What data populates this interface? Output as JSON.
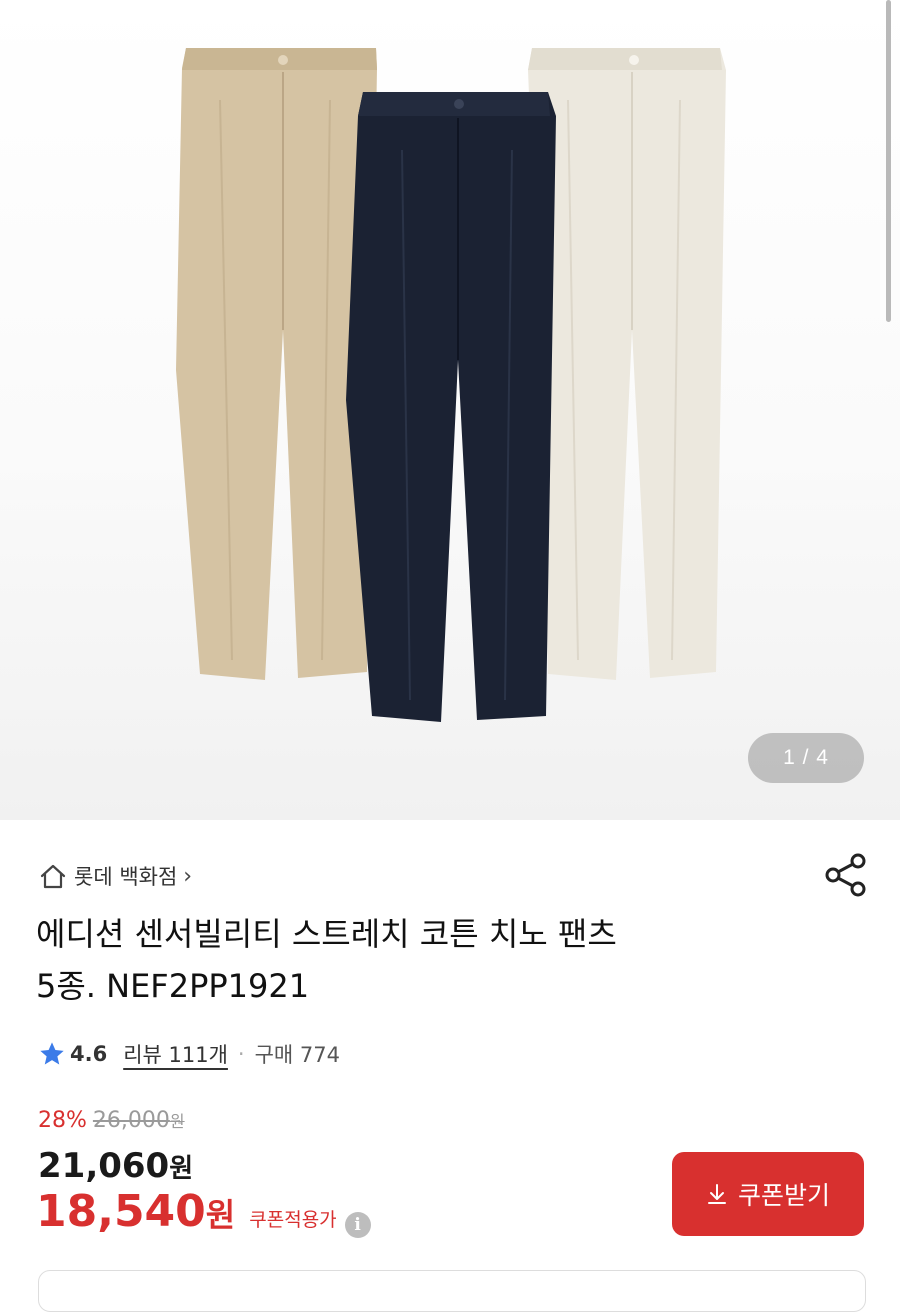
{
  "gallery": {
    "counter": "1 / 4",
    "image_alt": "chino-pants-three-colors",
    "colors": {
      "beige": "#d5c3a3",
      "navy": "#1b2233",
      "ivory": "#ece8de"
    }
  },
  "store": {
    "name": "롯데 백화점",
    "chevron": "›"
  },
  "product": {
    "title_line1": "에디션 센서빌리티 스트레치 코튼 치노 팬츠",
    "title_line2": "5종. NEF2PP1921"
  },
  "rating": {
    "score": "4.6",
    "reviews": "리뷰 111개",
    "separator": "·",
    "sales": "구매 774"
  },
  "pricing": {
    "discount_percent": "28%",
    "original_price": "26,000",
    "original_unit": "원",
    "sale_price": "21,060",
    "sale_unit": "원",
    "coupon_price": "18,540",
    "coupon_unit": "원",
    "coupon_label": "쿠폰적용가",
    "info_glyph": "i"
  },
  "coupon_button": {
    "label": "쿠폰받기"
  },
  "theme": {
    "accent": "#d8302f",
    "star": "#3b7be8"
  }
}
